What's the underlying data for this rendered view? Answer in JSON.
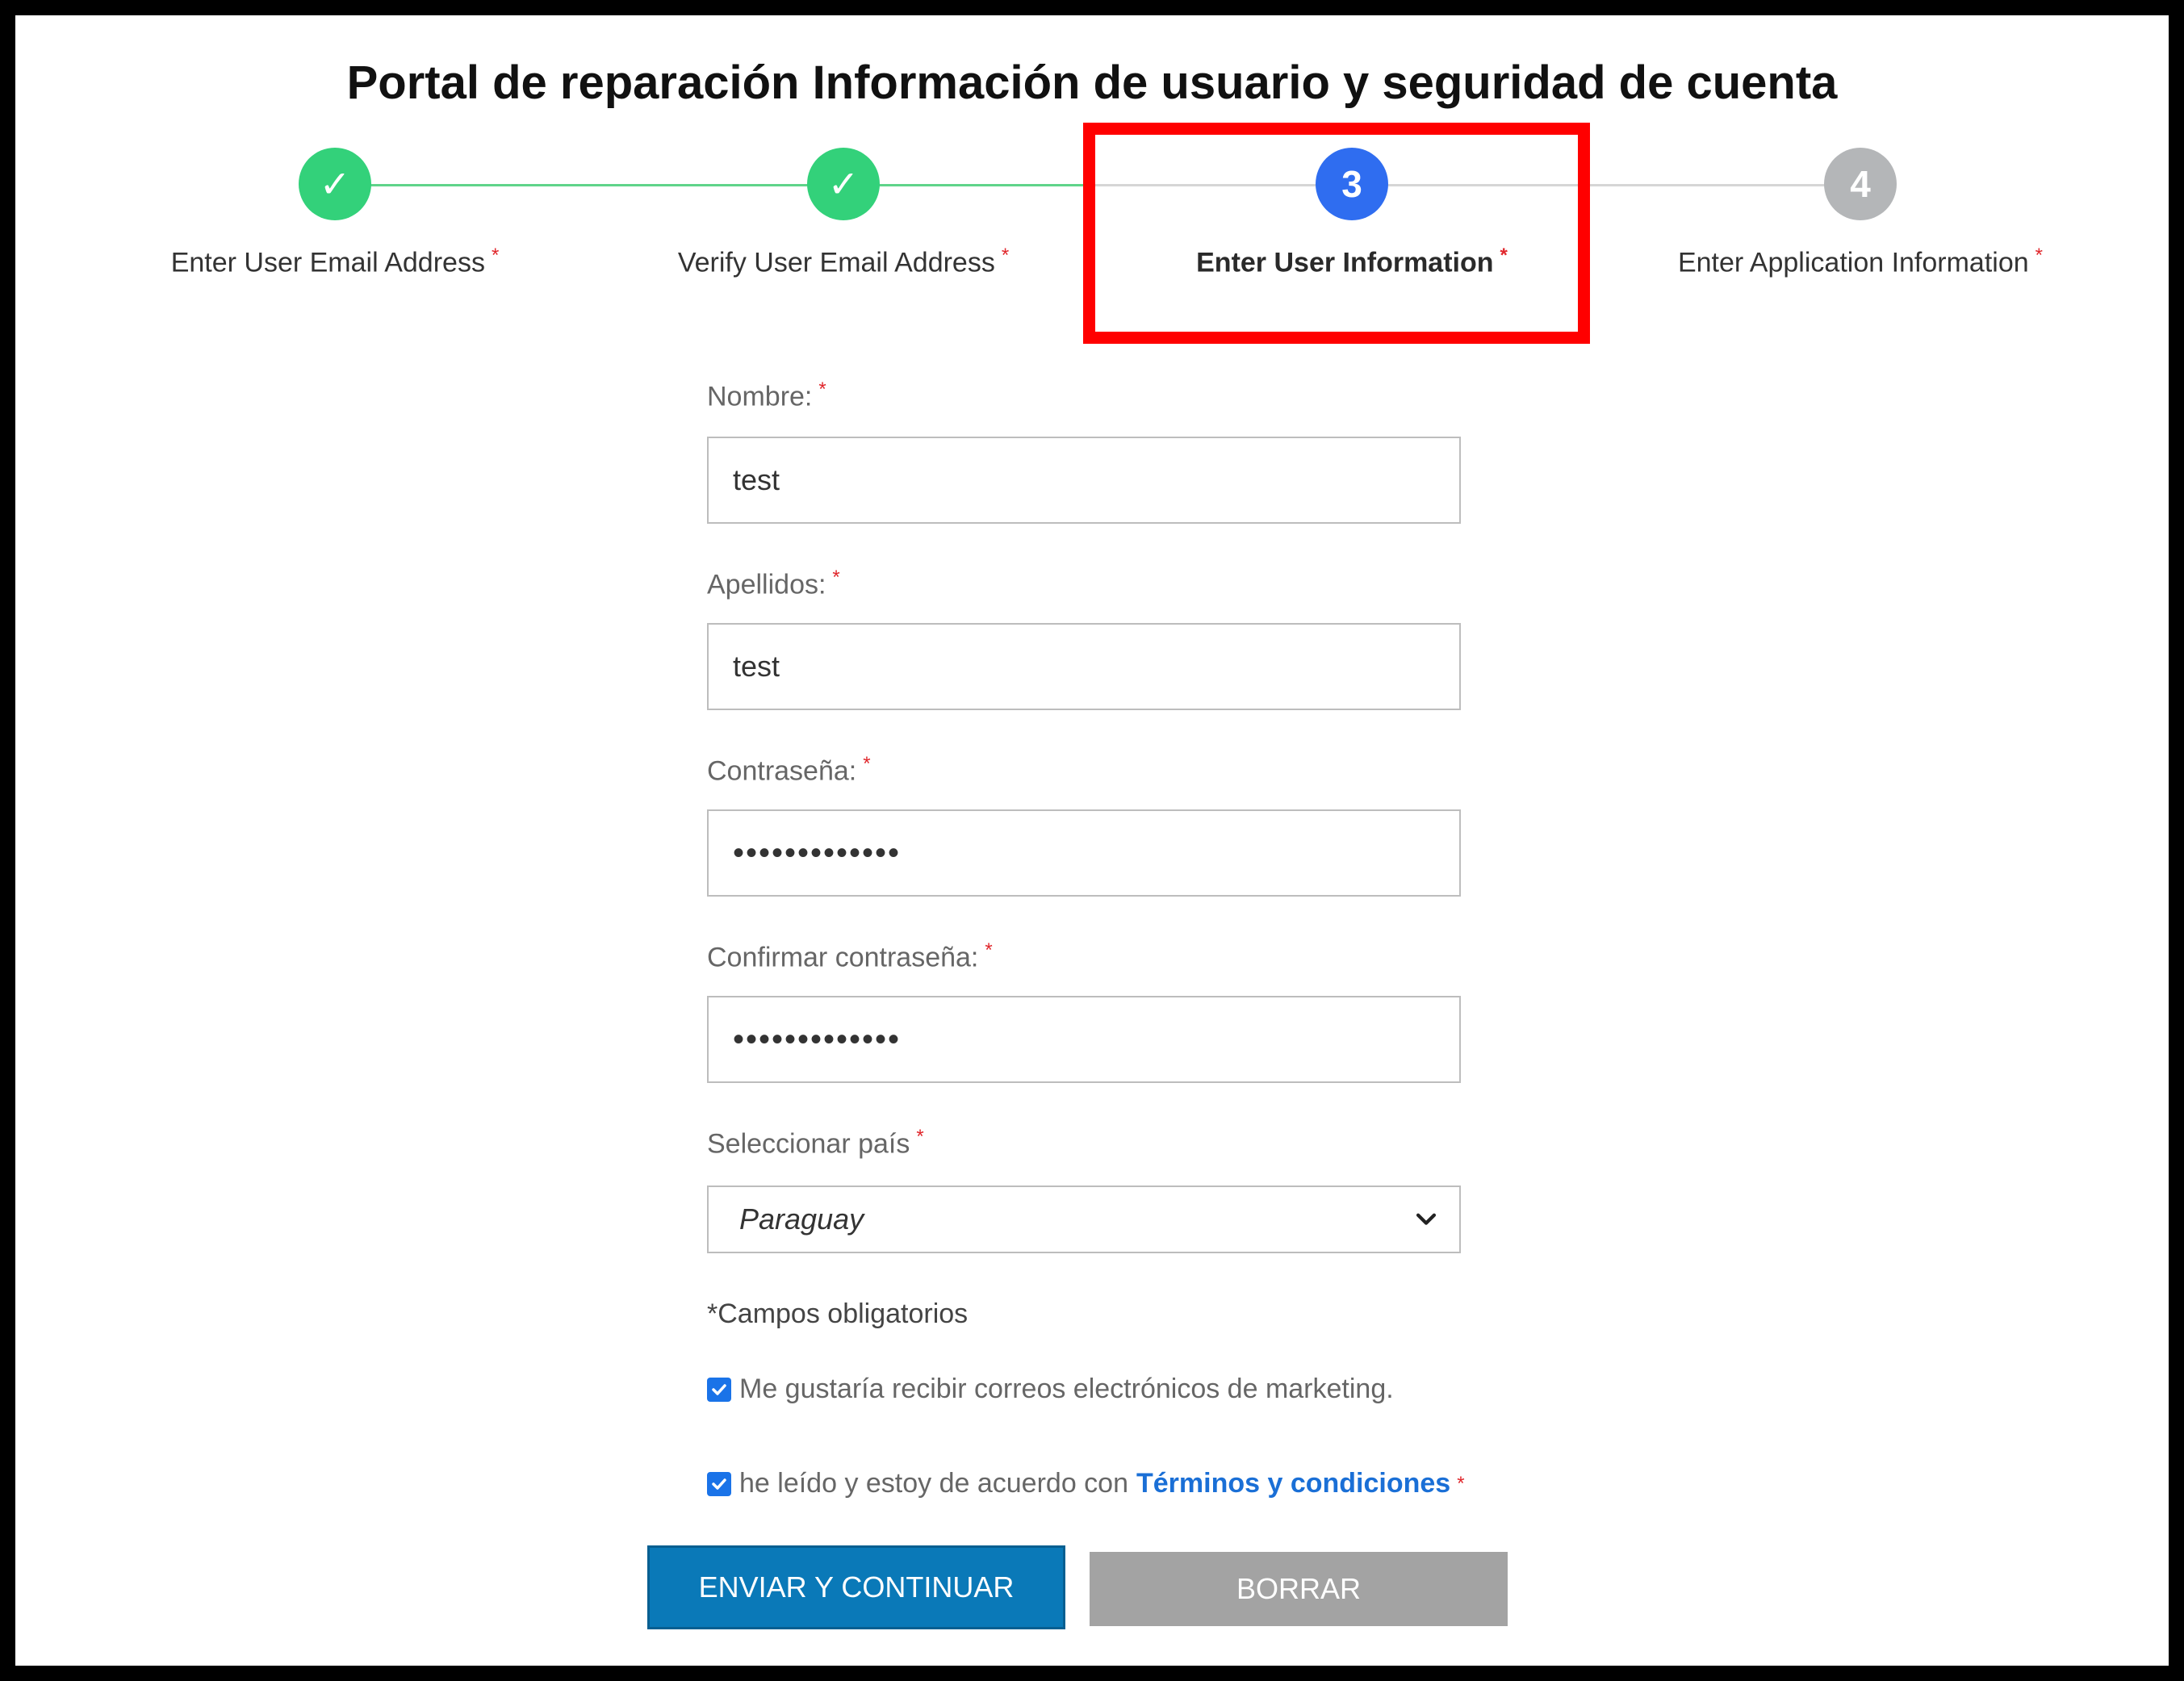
{
  "page": {
    "title": "Portal de reparación Información de usuario y seguridad de cuenta"
  },
  "stepper": {
    "steps": [
      {
        "number": "✓",
        "label": "Enter User Email Address",
        "state": "done"
      },
      {
        "number": "✓",
        "label": "Verify User Email Address",
        "state": "done"
      },
      {
        "number": "3",
        "label": "Enter User Information",
        "state": "active"
      },
      {
        "number": "4",
        "label": "Enter Application Information",
        "state": "pending"
      }
    ],
    "required_mark": "*"
  },
  "form": {
    "first_name": {
      "label": "Nombre:",
      "value": "test"
    },
    "last_name": {
      "label": "Apellidos:",
      "value": "test"
    },
    "password": {
      "label": "Contraseña:",
      "value": "•••••••••••••"
    },
    "confirm_password": {
      "label": "Confirmar contraseña:",
      "value": "•••••••••••••"
    },
    "country": {
      "label": "Seleccionar país",
      "value": "Paraguay"
    },
    "required_note": "*Campos obligatorios",
    "marketing": {
      "label": "Me gustaría recibir correos electrónicos de marketing.",
      "checked": true
    },
    "terms": {
      "label": "he leído y estoy de acuerdo con",
      "link": "Términos y condiciones",
      "checked": true
    },
    "submit_label": "ENVIAR Y CONTINUAR",
    "clear_label": "BORRAR"
  },
  "colors": {
    "done": "#33d17a",
    "active": "#2f6df0",
    "pending": "#b4b6b8",
    "highlight": "#ff0000",
    "primary_button": "#0a79b8",
    "secondary_button": "#a3a3a3",
    "link": "#1a6fd6",
    "required": "#e0262b"
  },
  "icons": {
    "step_done": "checkmark-icon",
    "select": "chevron-down-icon",
    "checkbox": "checkbox-checked-icon"
  }
}
